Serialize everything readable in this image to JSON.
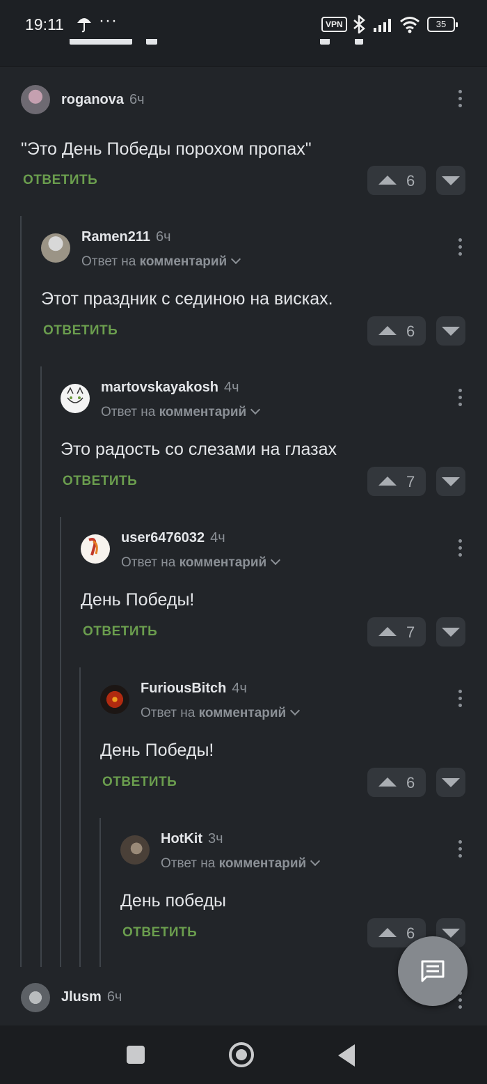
{
  "status_bar": {
    "time": "19:11",
    "vpn": "VPN",
    "battery": "35",
    "icons": [
      "umbrella-icon",
      "more-dots-icon",
      "vpn-icon",
      "bluetooth-icon",
      "signal-icon",
      "wifi-icon",
      "battery-icon"
    ]
  },
  "labels": {
    "reply_prefix": "Ответ на",
    "reply_target": "комментарий",
    "reply_button": "ОТВЕТИТЬ"
  },
  "comments": [
    {
      "author": "roganova",
      "time": "6ч",
      "reply": false,
      "text": "\"Это День Победы порохом пропах\"",
      "votes": "6"
    },
    {
      "author": "Ramen211",
      "time": "6ч",
      "reply": true,
      "text": "Этот праздник с сединою на висках.",
      "votes": "6"
    },
    {
      "author": "martovskayakosh",
      "time": "4ч",
      "reply": true,
      "text": "Это радость со слезами на глазах",
      "votes": "7"
    },
    {
      "author": "user6476032",
      "time": "4ч",
      "reply": true,
      "text": "День Победы!",
      "votes": "7"
    },
    {
      "author": "FuriousBitch",
      "time": "4ч",
      "reply": true,
      "text": "День Победы!",
      "votes": "6"
    },
    {
      "author": "HotKit",
      "time": "3ч",
      "reply": true,
      "text": "День победы",
      "votes": "6"
    }
  ],
  "next_comment": {
    "author": "Jlusm",
    "time": "6ч"
  },
  "colors": {
    "background": "#222529",
    "reply_green": "#6b9e4e",
    "muted": "#8b9096",
    "vote_bg": "#33373c"
  }
}
